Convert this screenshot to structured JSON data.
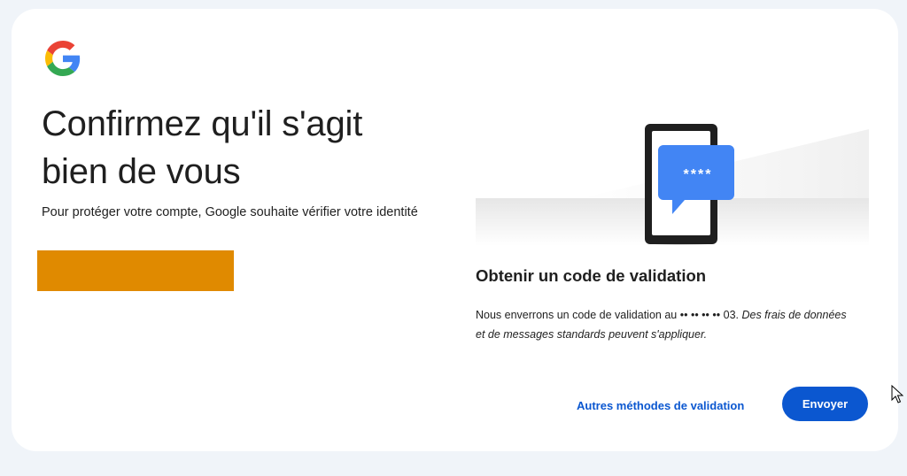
{
  "page": {
    "title_line1": "Confirmez qu'il s'agit",
    "title_line2": "bien de vous",
    "subtitle": "Pour protéger votre compte, Google souhaite vérifier votre identité"
  },
  "illustration": {
    "bubble_text": "****"
  },
  "validation": {
    "heading": "Obtenir un code de validation",
    "desc_prefix": "Nous enverrons un code de validation au ",
    "masked_phone": "•• •• •• •• 03",
    "desc_suffix": ". ",
    "desc_italic": "Des frais de données et de messages standards peuvent s'appliquer."
  },
  "actions": {
    "alt_methods_label": "Autres méthodes de validation",
    "send_label": "Envoyer"
  },
  "colors": {
    "primary": "#0b57d0",
    "redaction": "#e08a00",
    "background": "#f0f4f9"
  },
  "icons": {
    "logo": "google-g-logo",
    "cursor": "mouse-pointer-icon"
  }
}
